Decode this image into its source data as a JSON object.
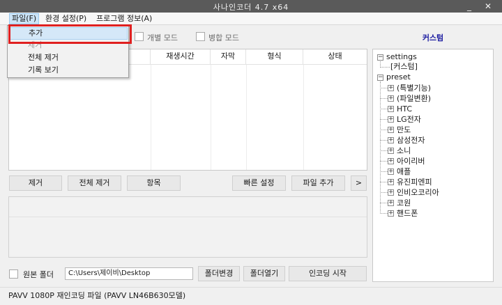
{
  "window": {
    "title": "사나인코더 4.7 x64",
    "minimize": "_",
    "close": "✕"
  },
  "menubar": {
    "file": "파일(F)",
    "settings": "환경 설정(P)",
    "about": "프로그램 정보(A)"
  },
  "file_menu": {
    "add": "추가",
    "remove": "제거",
    "remove_all": "전체 제거",
    "view_log": "기록 보기"
  },
  "modes": {
    "individual": "개별 모드",
    "merge": "병합 모드"
  },
  "table": {
    "columns": [
      "재생시간",
      "자막",
      "형식",
      "상태"
    ]
  },
  "buttons": {
    "remove": "제거",
    "remove_all": "전체 제거",
    "items": "항목",
    "quick_settings": "빠른 설정",
    "add_file": "파일 추가",
    "more": ">",
    "change_folder": "폴더변경",
    "open_folder": "폴더열기",
    "start_encoding": "인코딩 시작"
  },
  "output": {
    "source_folder_label": "원본 폴더",
    "path": "C:\\Users\\제이비\\Desktop"
  },
  "presets": {
    "title": "커스텀",
    "settings_root": "settings",
    "settings_child": "[커스텀]",
    "preset_root": "preset",
    "items": [
      "(특별기능)",
      "(파일변환)",
      "HTC",
      "LG전자",
      "만도",
      "삼성전자",
      "소니",
      "아이리버",
      "애플",
      "유진피엔피",
      "인비오코리아",
      "코원",
      "핸드폰"
    ]
  },
  "status": {
    "text": "PAVV 1080P 재인코딩 파일 (PAVV LN46B630모델)"
  },
  "colors": {
    "highlight_box": "#e02020",
    "preset_title": "#1a1aa0",
    "menu_highlight": "#cce4f7"
  }
}
